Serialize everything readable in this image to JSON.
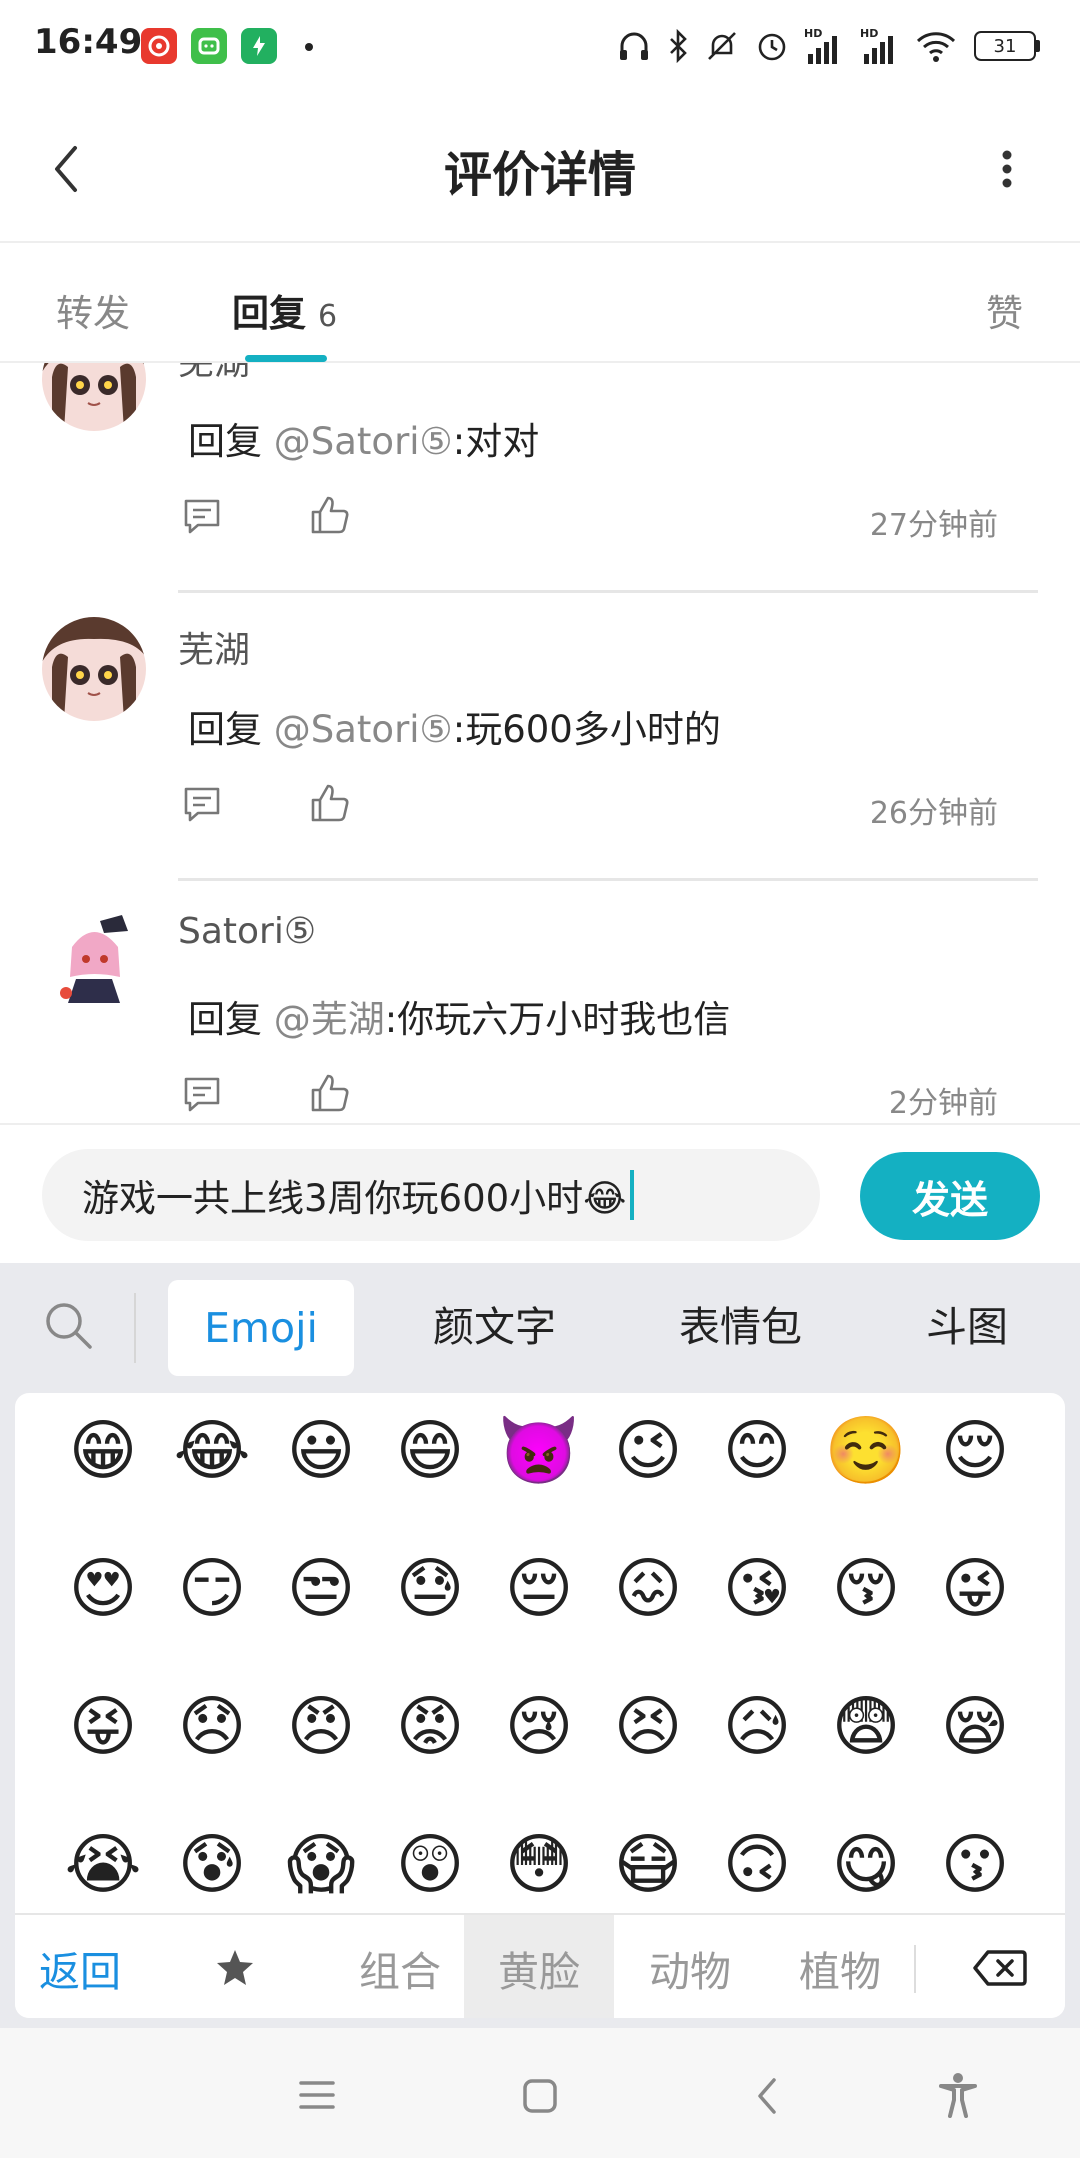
{
  "status_bar": {
    "time": "16:49",
    "battery": "31",
    "apps": [
      "netease-music-icon",
      "mini-app-icon",
      "power-app-icon"
    ],
    "hd1": "HD",
    "hd2": "HD"
  },
  "header": {
    "title": "评价详情",
    "back_icon": "chevron-left-icon",
    "more_icon": "more-vertical-icon"
  },
  "tabs": {
    "forward": "转发",
    "reply": "回复",
    "reply_count": "6",
    "likes": "赞"
  },
  "replies": [
    {
      "user": "芜湖",
      "prefix": "回复 ",
      "mention": "@Satori⑤",
      "text": ":对对",
      "time": "27分钟前"
    },
    {
      "user": "芜湖",
      "prefix": "回复 ",
      "mention": "@Satori⑤",
      "text": ":玩600多小时的",
      "time": "26分钟前"
    },
    {
      "user": "Satori⑤",
      "prefix": "回复 ",
      "mention": "@芜湖",
      "text": ":你玩六万小时我也信",
      "time": "2分钟前"
    }
  ],
  "input": {
    "value": "游戏一共上线3周你玩600小时😂",
    "send_label": "发送"
  },
  "keyboard": {
    "tabs": [
      "Emoji",
      "颜文字",
      "表情包",
      "斗图"
    ],
    "emojis": [
      [
        "😁",
        "😂",
        "😃",
        "😄",
        "👿",
        "😉",
        "😊",
        "☺️",
        "😌"
      ],
      [
        "😍",
        "😏",
        "😒",
        "😓",
        "😔",
        "😖",
        "😘",
        "😚",
        "😜"
      ],
      [
        "😝",
        "😞",
        "😠",
        "😡",
        "😢",
        "😣",
        "😥",
        "😨",
        "😪"
      ],
      [
        "😭",
        "😰",
        "😱",
        "😲",
        "😳",
        "😷",
        "🙃",
        "😋",
        "😗"
      ]
    ],
    "categories": {
      "back": "返回",
      "combo": "组合",
      "yellow_face": "黄脸",
      "animal": "动物",
      "plant": "植物"
    }
  },
  "colors": {
    "accent": "#14b0c2",
    "link_blue": "#1a8fe0"
  }
}
